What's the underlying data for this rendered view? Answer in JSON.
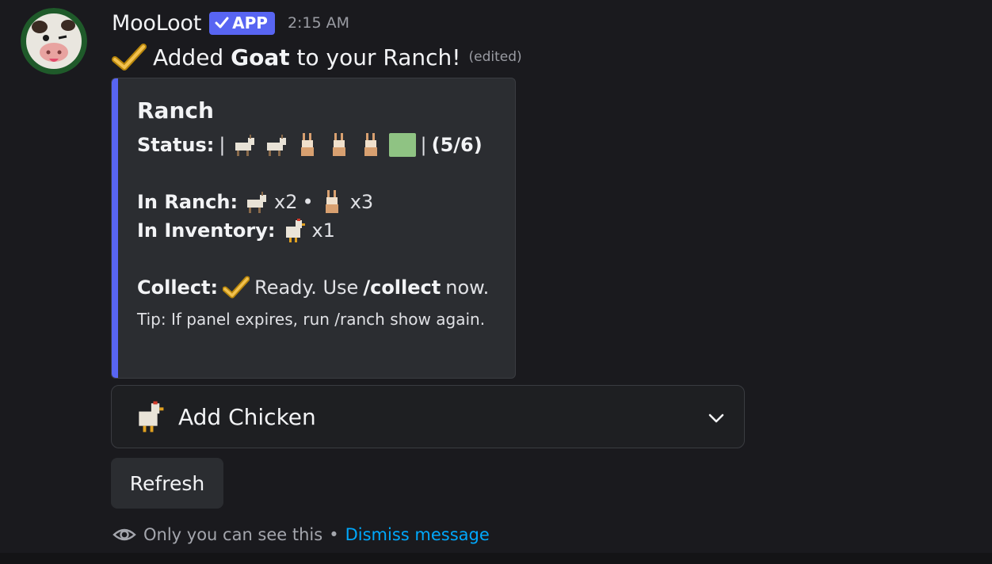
{
  "message": {
    "author": "MooLoot",
    "badge": "APP",
    "time": "2:15 AM",
    "content_prefix": "Added ",
    "content_bold": "Goat",
    "content_suffix": " to your Ranch!",
    "edited": "(edited)"
  },
  "embed": {
    "accent_color": "#5865f2",
    "title": "Ranch",
    "status_label": "Status:",
    "status_open": "|",
    "status_slots": [
      "goat-icon",
      "goat-icon",
      "rabbit-icon",
      "rabbit-icon",
      "rabbit-icon",
      "empty-slot"
    ],
    "status_close": "|",
    "status_count": "(5/6)",
    "in_ranch_label": "In Ranch:",
    "in_ranch_goat_count": "x2",
    "separator": "•",
    "in_ranch_rabbit_count": "x3",
    "inventory_label": "In Inventory:",
    "inventory_chicken_count": "x1",
    "collect_label": "Collect:",
    "collect_text_1": "Ready. Use",
    "collect_cmd": "/collect",
    "collect_text_2": "now.",
    "tip": "Tip: If panel expires, run /ranch show again."
  },
  "select_menu": {
    "icon": "chicken-icon",
    "label": "Add Chicken"
  },
  "refresh_button": {
    "label": "Refresh"
  },
  "footer": {
    "notice": "Only you can see this",
    "separator": "•",
    "dismiss": "Dismiss message"
  }
}
